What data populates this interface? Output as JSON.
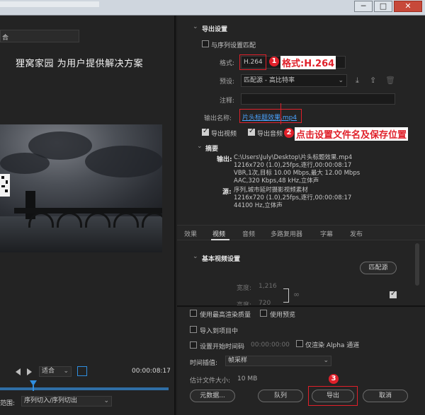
{
  "window": {
    "title_blurred": "",
    "minimize_glyph": "─",
    "maximize_glyph": "□",
    "close_glyph": "✕"
  },
  "left_panel": {
    "source_dropdown": "合",
    "overlay_text": "狸窝家园 为用户提供解决方案",
    "fit_label": "适合",
    "timecode": "00:00:08:17",
    "range_label": "范围:",
    "range_value": "序列切入/序列切出"
  },
  "export_settings": {
    "title": "导出设置",
    "match_sequence_label": "与序列设置匹配",
    "format_label": "格式:",
    "format_value": "H.264",
    "preset_label": "预设:",
    "preset_value": "匹配源 - 高比特率",
    "comments_label": "注释:",
    "comments_value": "",
    "output_name_label": "输出名称:",
    "output_name_value": "片头标题效果.mp4",
    "export_video_label": "导出视频",
    "export_audio_label": "导出音频"
  },
  "summary": {
    "title": "摘要",
    "output_label": "输出:",
    "output_lines": [
      "C:\\Users\\July\\Desktop\\片头标题效果.mp4",
      "1216x720 (1.0),25fps,逐行,00:00:08:17",
      "VBR,1次,目标 10.00 Mbps,最大 12.00 Mbps",
      "AAC,320 Kbps,48 kHz,立体声"
    ],
    "source_label": "源:",
    "source_lines": [
      "序列,城市延时摄影视频素材",
      "1216x720 (1.0),25fps,逐行,00:00:08:17",
      "44100 Hz,立体声"
    ]
  },
  "tabs": [
    "效果",
    "视频",
    "音频",
    "多路复用器",
    "字幕",
    "发布"
  ],
  "active_tab": "视频",
  "basic_video": {
    "title": "基本视频设置",
    "match_source_button": "匹配源",
    "width_label": "宽度:",
    "width_value": "1,216",
    "height_label": "高度:",
    "height_value": "720"
  },
  "bottom_options": {
    "max_render_quality": "使用最高渲染质量",
    "use_previews": "使用预览",
    "import_into_project": "导入到项目中",
    "set_start_timecode": "设置开始时间码",
    "start_timecode_value": "00:00:00:00",
    "render_alpha_only": "仅渲染 Alpha 通道",
    "time_interpolation_label": "时间插值:",
    "time_interpolation_value": "帧采样",
    "estimated_size_label": "估计文件大小:",
    "estimated_size_value": "10 MB"
  },
  "buttons": {
    "metadata": "元数据...",
    "queue": "队列",
    "export": "导出",
    "cancel": "取消"
  },
  "annotations": {
    "badge_1": "1",
    "text_1": "格式:H.264",
    "badge_2": "2",
    "text_2": "点击设置文件名及保存位置",
    "badge_3": "3"
  },
  "colors": {
    "annotation_red": "#e0202a",
    "link_blue": "#4aa3ff",
    "scrubber_blue": "#2f6ea6"
  }
}
